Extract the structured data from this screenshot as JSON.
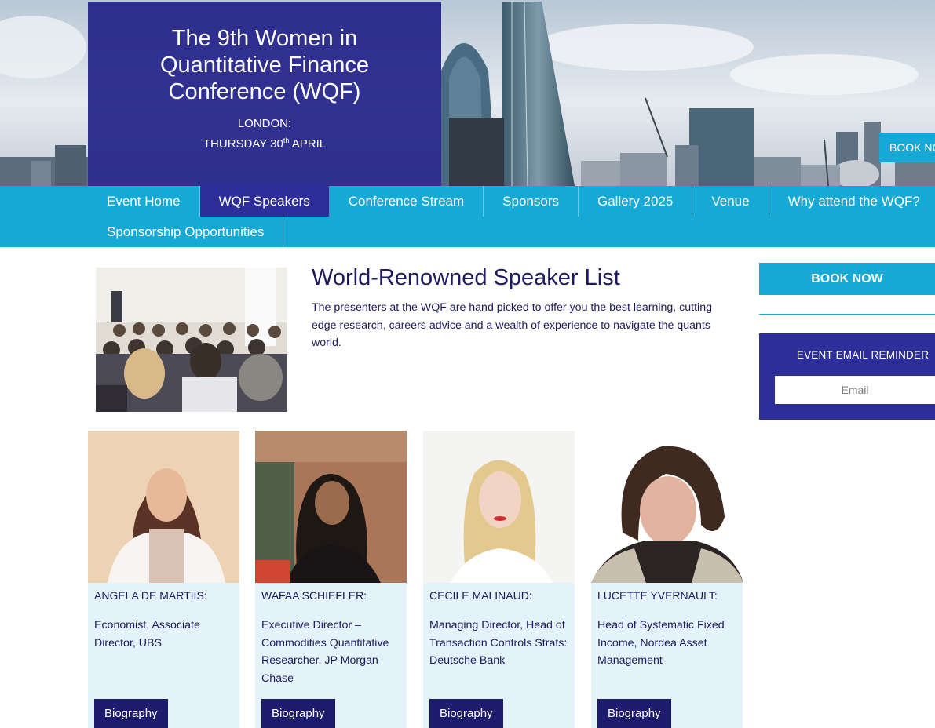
{
  "hero": {
    "title": "The 9th Women in Quantitative Finance Conference (WQF)",
    "city": "LONDON:",
    "date_prefix": "THURSDAY 30",
    "date_sup": "th",
    "date_suffix": " APRIL",
    "book_label": "BOOK NOW"
  },
  "nav": {
    "items": [
      {
        "label": "Event Home",
        "active": false
      },
      {
        "label": "WQF Speakers",
        "active": true
      },
      {
        "label": "Conference Stream",
        "active": false
      },
      {
        "label": "Sponsors",
        "active": false
      },
      {
        "label": "Gallery 2025",
        "active": false
      },
      {
        "label": "Venue",
        "active": false
      },
      {
        "label": "Why attend the WQF?",
        "active": false
      },
      {
        "label": "Sponsorship Opportunities",
        "active": false
      }
    ]
  },
  "intro": {
    "title": "World-Renowned Speaker List",
    "text": "The presenters at the WQF are hand picked to offer you the best learning, cutting edge research, careers advice and a wealth of experience to navigate the quants world."
  },
  "sidebar": {
    "book_label": "BOOK NOW",
    "reminder_title": "EVENT EMAIL REMINDER",
    "email_placeholder": "Email"
  },
  "speakers": [
    {
      "name": "ANGELA DE MARTIIS:",
      "role": "Economist, Associate Director, UBS",
      "button": "Biography"
    },
    {
      "name": "WAFAA SCHIEFLER:",
      "role": "Executive Director – Commodities Quantitative Researcher, JP Morgan Chase",
      "button": "Biography"
    },
    {
      "name": "CECILE MALINAUD:",
      "role": "Managing Director, Head of Transaction Controls Strats: Deutsche Bank",
      "button": "Biography"
    },
    {
      "name": "LUCETTE YVERNAULT:",
      "role": "Head of Systematic Fixed Income, Nordea Asset Management",
      "button": "Biography"
    }
  ],
  "colors": {
    "navy": "#24228a",
    "cyan": "#16a9d6",
    "text": "#1d1b5e",
    "card_bg": "#e4f3f9"
  }
}
